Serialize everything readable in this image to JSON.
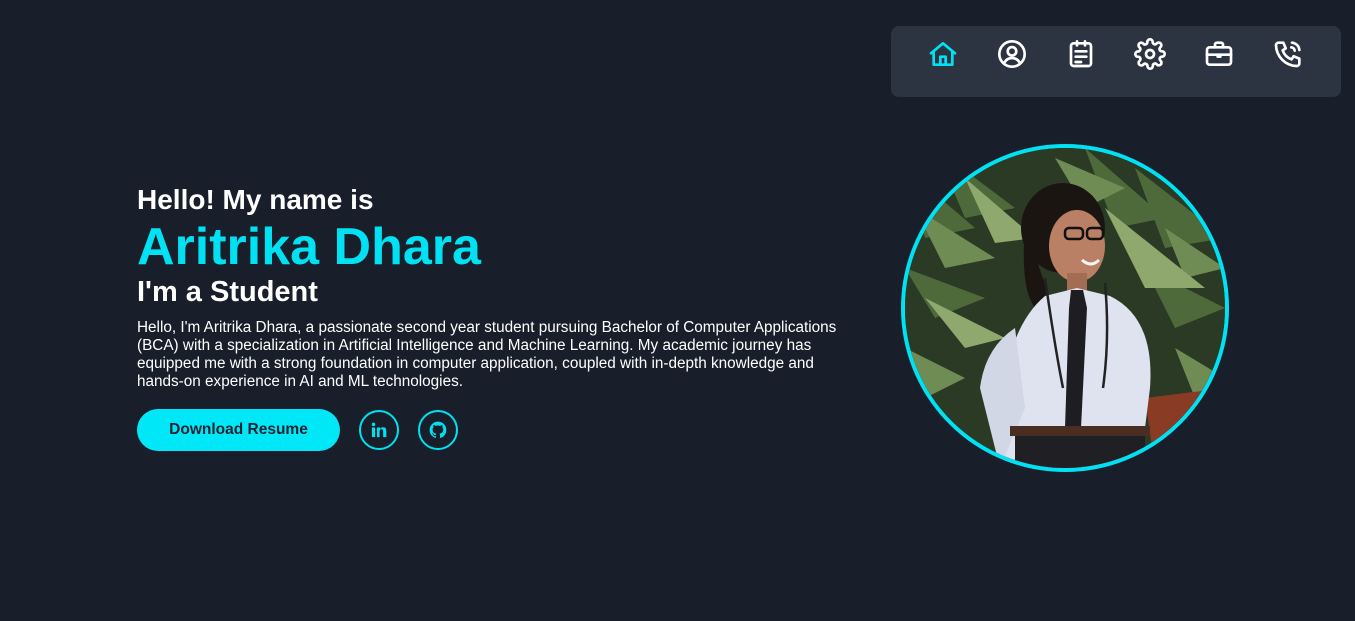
{
  "nav": {
    "items": [
      {
        "icon": "home-icon",
        "active": true
      },
      {
        "icon": "user-circle-icon",
        "active": false
      },
      {
        "icon": "document-icon",
        "active": false
      },
      {
        "icon": "gear-icon",
        "active": false
      },
      {
        "icon": "briefcase-icon",
        "active": false
      },
      {
        "icon": "phone-icon",
        "active": false
      }
    ],
    "active_color": "#00e1f3",
    "inactive_color": "#ffffff"
  },
  "hero": {
    "greeting": "Hello! My name is",
    "name": "Aritrika Dhara",
    "role": "I'm a Student",
    "bio": "Hello, I'm Aritrika Dhara, a passionate second year student pursuing Bachelor of Computer Applications (BCA) with a specialization in Artificial Intelligence and Machine Learning. My academic journey has equipped me with a strong foundation in computer application, coupled with in-depth knowledge and hands-on experience in AI and ML technologies.",
    "resume_label": "Download Resume",
    "social": [
      {
        "icon": "linkedin-icon"
      },
      {
        "icon": "github-icon"
      }
    ]
  },
  "profile": {
    "photo_alt": "profile-photo"
  },
  "colors": {
    "background": "#181f2b",
    "nav_background": "#2c3442",
    "accent": "#00e1f3"
  }
}
